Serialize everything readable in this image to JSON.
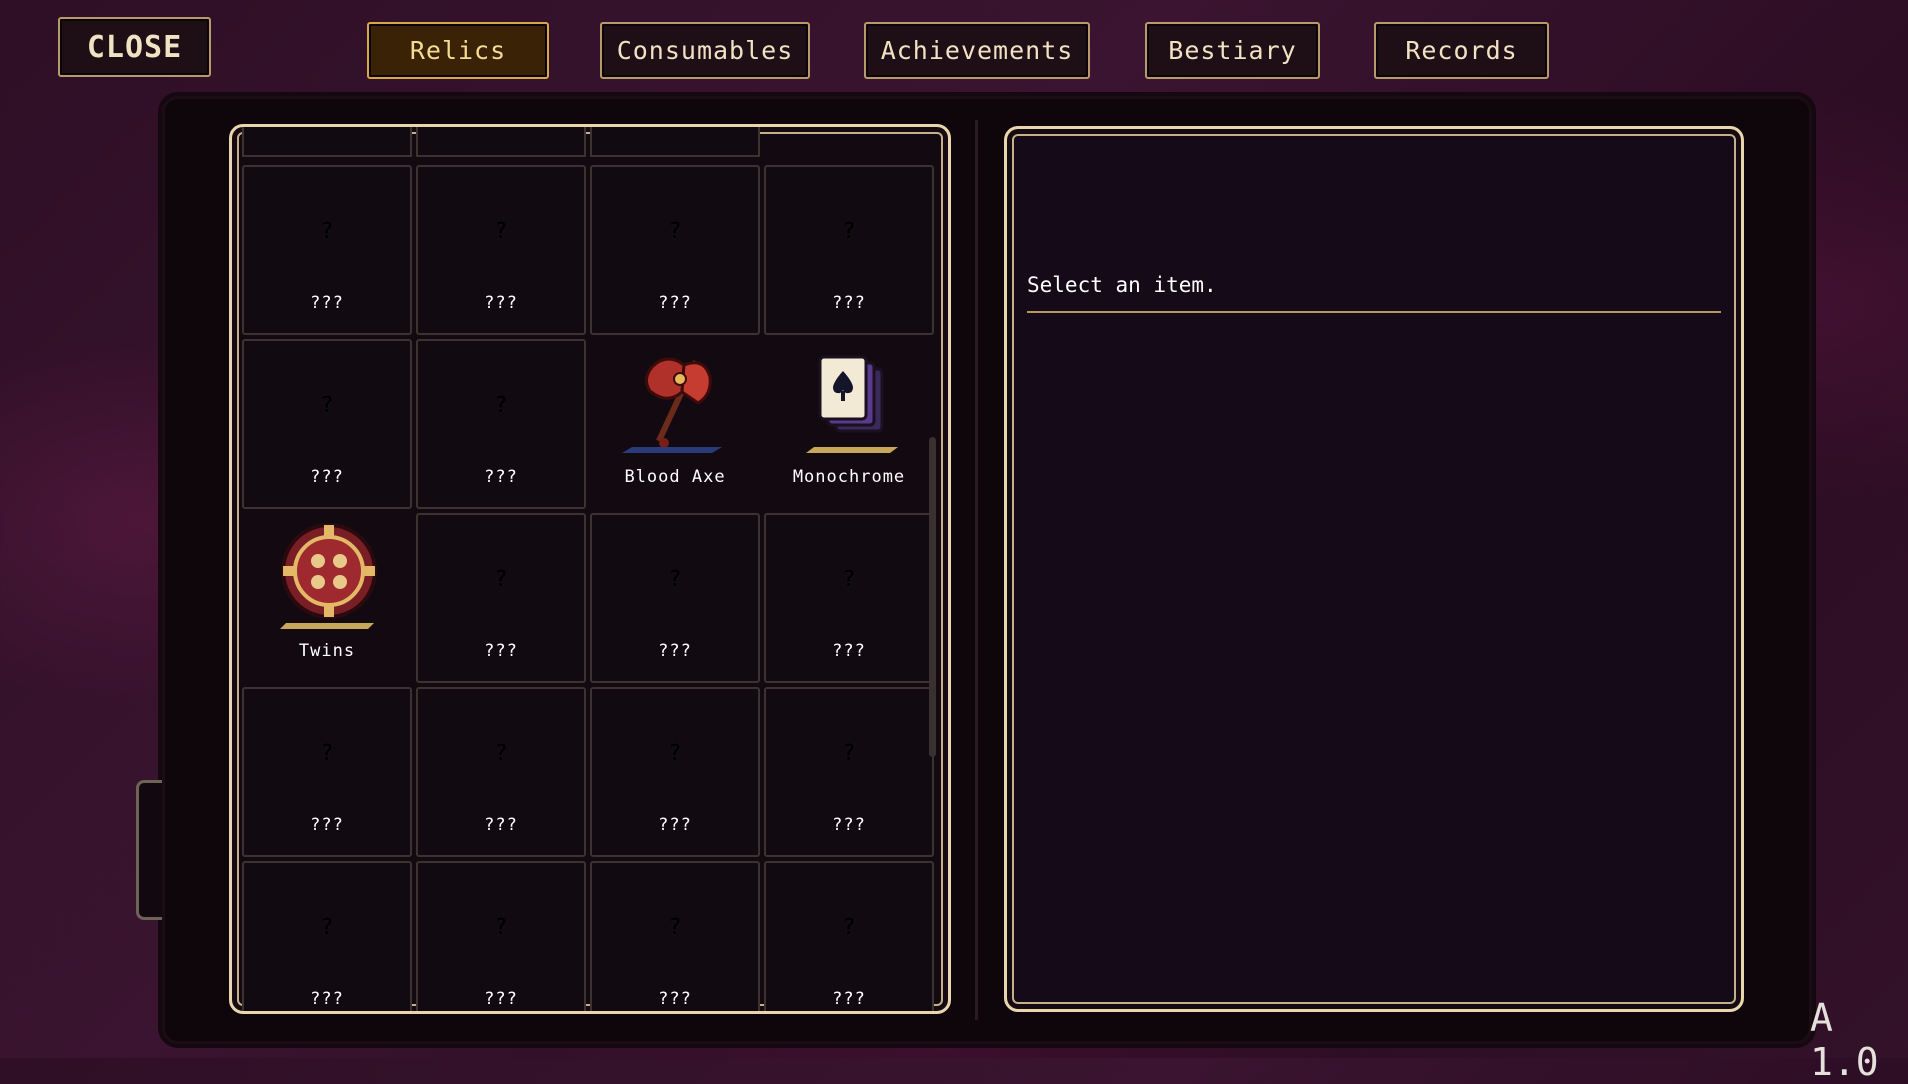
{
  "close_label": "CLOSE",
  "tabs": [
    {
      "label": "Relics",
      "active": true
    },
    {
      "label": "Consumables",
      "active": false
    },
    {
      "label": "Achievements",
      "active": false
    },
    {
      "label": "Bestiary",
      "active": false
    },
    {
      "label": "Records",
      "active": false
    }
  ],
  "unknown_label": "???",
  "unknown_icon": "?",
  "items": [
    {
      "label": "???",
      "icon": "unknown-icon"
    },
    {
      "label": "???",
      "icon": "unknown-icon"
    },
    {
      "label": "???",
      "icon": "unknown-icon"
    },
    {
      "label": "???",
      "icon": "unknown-icon"
    },
    {
      "label": "???",
      "icon": "unknown-icon"
    },
    {
      "label": "???",
      "icon": "unknown-icon"
    },
    {
      "label": "Blood Axe",
      "icon": "blood-axe-icon"
    },
    {
      "label": "Monochrome",
      "icon": "monochrome-card-icon"
    },
    {
      "label": "Twins",
      "icon": "twins-chip-icon"
    },
    {
      "label": "???",
      "icon": "unknown-icon"
    },
    {
      "label": "???",
      "icon": "unknown-icon"
    },
    {
      "label": "???",
      "icon": "unknown-icon"
    },
    {
      "label": "???",
      "icon": "unknown-icon"
    },
    {
      "label": "???",
      "icon": "unknown-icon"
    },
    {
      "label": "???",
      "icon": "unknown-icon"
    },
    {
      "label": "???",
      "icon": "unknown-icon"
    },
    {
      "label": "???",
      "icon": "unknown-icon"
    },
    {
      "label": "???",
      "icon": "unknown-icon"
    },
    {
      "label": "???",
      "icon": "unknown-icon"
    },
    {
      "label": "???",
      "icon": "unknown-icon"
    }
  ],
  "info": {
    "prompt": "Select an item."
  },
  "version": "A 1.0",
  "colors": {
    "active_tab": "#3a2206",
    "frame_gold": "#e9d6ad",
    "background": "#2e0f26"
  }
}
